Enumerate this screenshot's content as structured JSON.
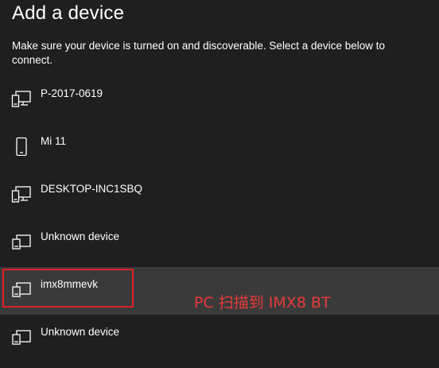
{
  "header": {
    "title": "Add a device",
    "description": "Make sure your device is turned on and discoverable. Select a device below to connect."
  },
  "devices": [
    {
      "name": "P-2017-0619",
      "icon": "desktop-pc-icon"
    },
    {
      "name": "Mi 11",
      "icon": "phone-icon"
    },
    {
      "name": "DESKTOP-INC1SBQ",
      "icon": "desktop-pc-icon"
    },
    {
      "name": "Unknown device",
      "icon": "generic-device-icon"
    },
    {
      "name": "imx8mmevk",
      "icon": "generic-device-icon"
    },
    {
      "name": "Unknown device",
      "icon": "generic-device-icon"
    }
  ],
  "annotation": {
    "text": "PC 扫描到 IMX8 BT",
    "color": "#e83a3a"
  },
  "colors": {
    "background": "#1f1f1f",
    "selected_row": "#3a3a3a",
    "highlight_border": "#e02020"
  }
}
